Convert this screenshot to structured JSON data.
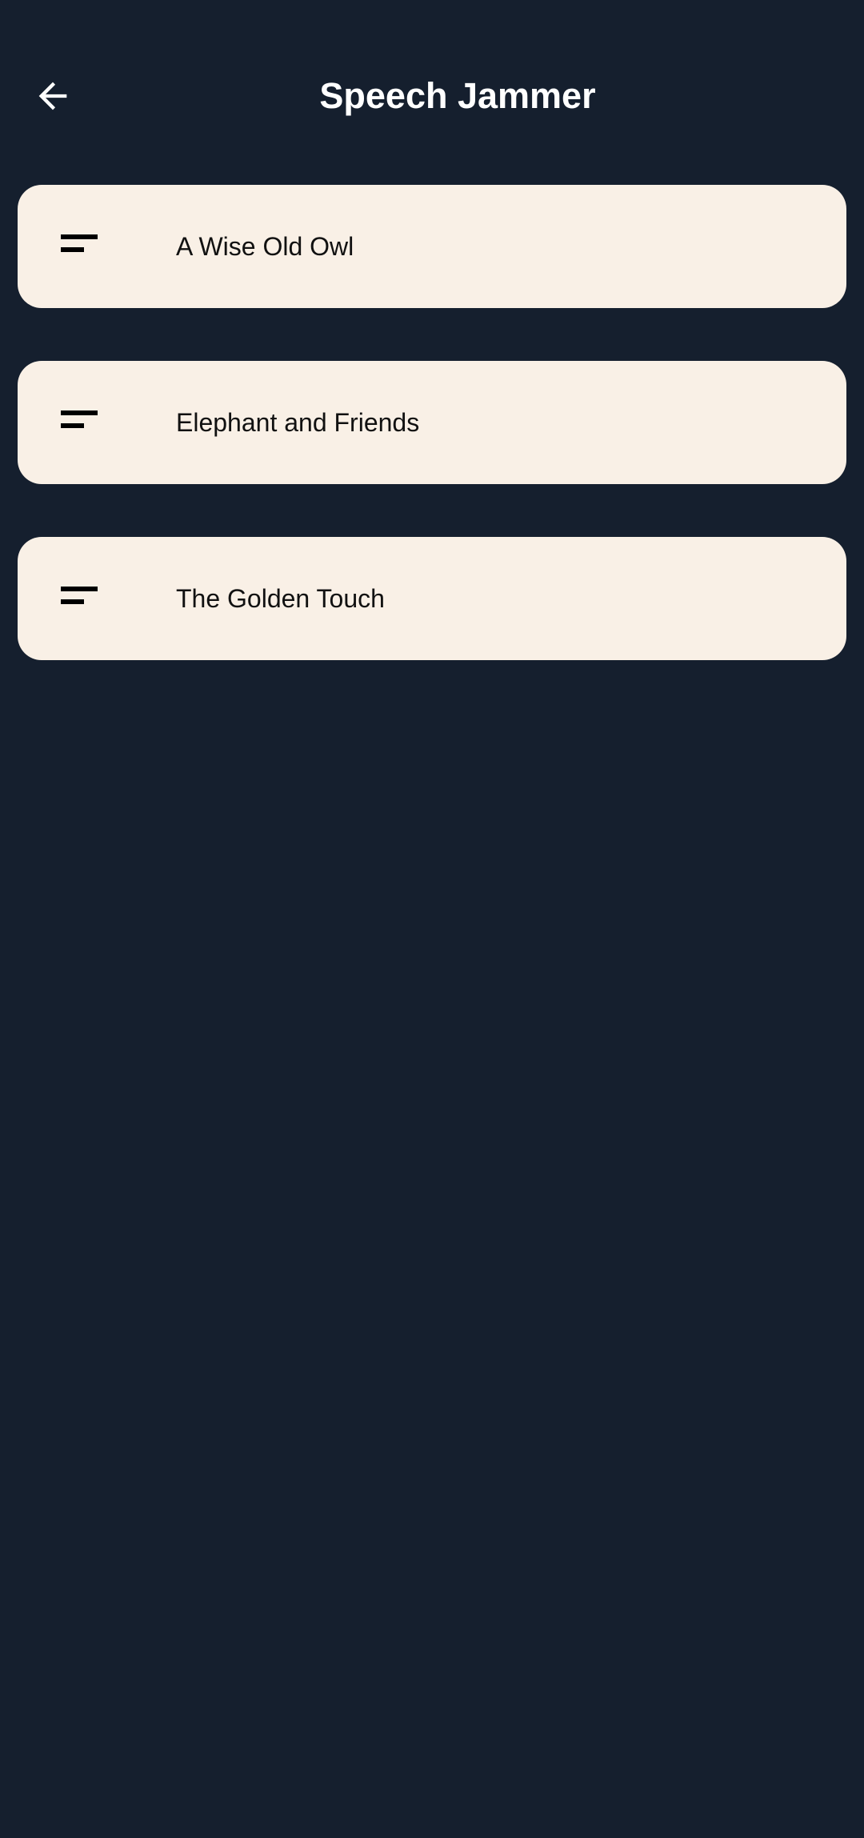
{
  "header": {
    "title": "Speech Jammer",
    "back_icon": "arrow-back-icon"
  },
  "colors": {
    "background": "#151f2e",
    "card": "#f9f0e6",
    "title_text": "#ffffff",
    "card_text": "#111111"
  },
  "stories": [
    {
      "label": "A Wise Old Owl",
      "icon": "short-text-icon"
    },
    {
      "label": "Elephant and Friends",
      "icon": "short-text-icon"
    },
    {
      "label": "The Golden Touch",
      "icon": "short-text-icon"
    }
  ]
}
